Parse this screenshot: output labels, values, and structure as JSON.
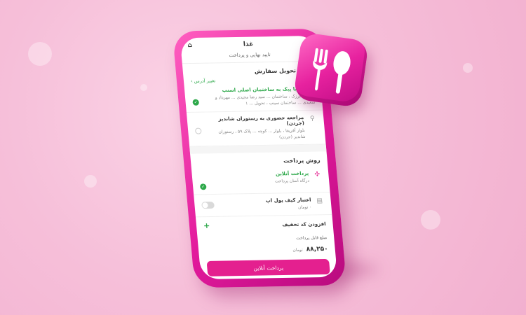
{
  "app": {
    "title": "غذا",
    "subtitle": "تایید نهایی و پرداخت"
  },
  "delivery": {
    "section_title": "روش تحویل سفارش",
    "change_address": "تغییر آدرس",
    "options": [
      {
        "title": "ارسال با پیک به ساختمان اصلی اسنپ",
        "description": "جردن ، برزک ، ساختمان ... سید رضا مجیدی ... مهرداد و سعیدی ... ساختمان سینپ ، تحویل ... ۱",
        "selected": true
      },
      {
        "title": "مراجعه حضوری به رستوران شاندیز (جردن)",
        "description": "بلوار آفریقا ، بلوار ... کوچه ... پلاک ۵۹ ، رستوران شاندیز (جردن)",
        "selected": false
      }
    ]
  },
  "payment": {
    "section_title": "روش پرداخت",
    "options": [
      {
        "title": "پرداخت آنلاین",
        "description": "درگاه آسان پرداخت",
        "selected": true
      },
      {
        "title": "اعتبار کیف پول اپ",
        "description": "۰ تومان"
      }
    ]
  },
  "discount": {
    "label": "افزودن کد تخفیف",
    "add_icon": "plus-icon"
  },
  "total": {
    "label": "مبلغ قابل پرداخت",
    "value": "۸۸,۲۵۰",
    "unit": "تومان"
  },
  "pay_button": "پرداخت آنلاین",
  "colors": {
    "brand": "#e4208f",
    "success": "#2da84a",
    "background": "#f6bfd9"
  },
  "icons": {
    "app_icon": "fork-spoon-icon",
    "back": "back-arrow-icon",
    "home": "home-icon"
  }
}
